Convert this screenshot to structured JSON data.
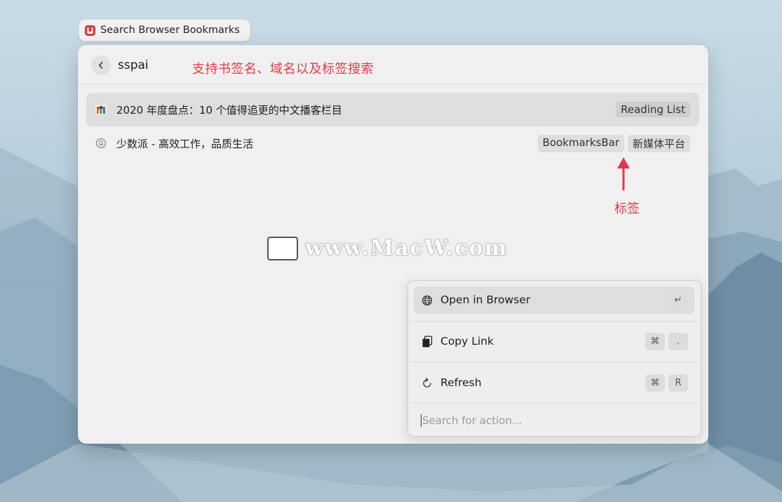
{
  "window_title": "Search Browser Bookmarks",
  "search": {
    "query": "sspai"
  },
  "annotations": {
    "top": "支持书签名、域名以及标签搜索",
    "tag_pointer": "标签"
  },
  "results": [
    {
      "title": "2020 年度盘点：10 个值得追更的中文播客栏目",
      "icon": "podcast-favicon",
      "tags": [
        "Reading List"
      ],
      "selected": true
    },
    {
      "title": "少数派 - 高效工作，品质生活",
      "icon": "sspai-favicon",
      "tags": [
        "BookmarksBar",
        "新媒体平台"
      ],
      "selected": false
    }
  ],
  "watermark": "www.MacW.com",
  "actions": [
    {
      "label": "Open in Browser",
      "icon": "globe-icon",
      "keys": [
        "↵"
      ],
      "selected": true
    },
    {
      "label": "Copy Link",
      "icon": "copy-icon",
      "keys": [
        "⌘",
        "."
      ],
      "selected": false
    },
    {
      "label": "Refresh",
      "icon": "refresh-icon",
      "keys": [
        "⌘",
        "R"
      ],
      "selected": false
    }
  ],
  "action_search": {
    "placeholder": "Search for action..."
  },
  "colors": {
    "annotation": "#e23a4a",
    "app_icon": "#d93a3a"
  }
}
